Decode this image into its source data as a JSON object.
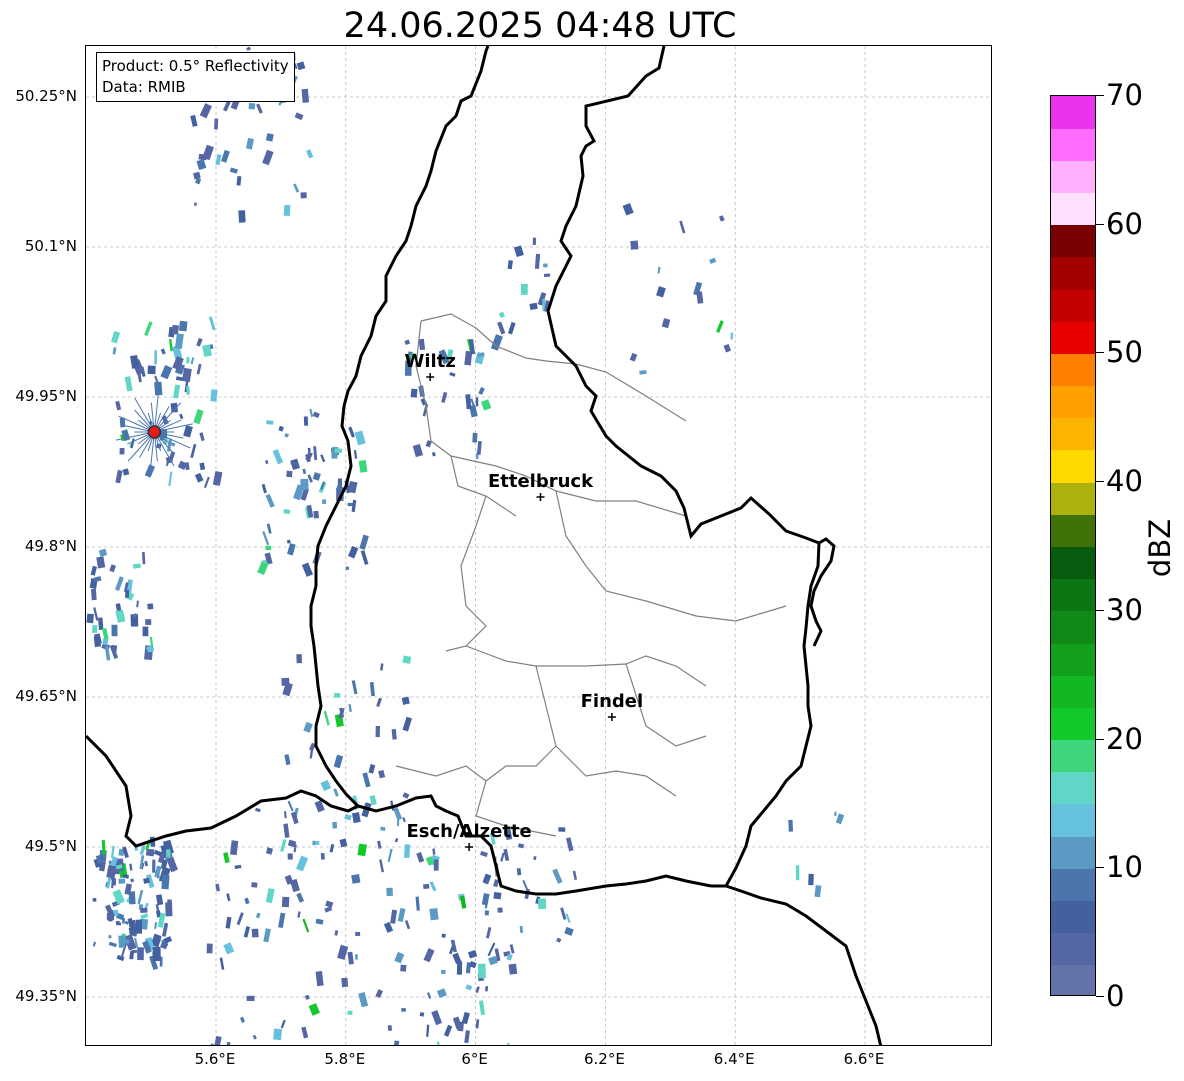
{
  "title": "24.06.2025 04:48 UTC",
  "info": {
    "product": "Product: 0.5° Reflectivity",
    "data_source": "Data: RMIB"
  },
  "axes": {
    "lon_range": [
      5.4,
      6.8
    ],
    "lat_range": [
      49.3,
      50.3
    ],
    "x_ticks": [
      {
        "value": 5.6,
        "label": "5.6°E"
      },
      {
        "value": 5.8,
        "label": "5.8°E"
      },
      {
        "value": 6.0,
        "label": "6°E"
      },
      {
        "value": 6.2,
        "label": "6.2°E"
      },
      {
        "value": 6.4,
        "label": "6.4°E"
      },
      {
        "value": 6.6,
        "label": "6.6°E"
      }
    ],
    "y_ticks": [
      {
        "value": 50.25,
        "label": "50.25°N"
      },
      {
        "value": 50.1,
        "label": "50.1°N"
      },
      {
        "value": 49.95,
        "label": "49.95°N"
      },
      {
        "value": 49.8,
        "label": "49.8°N"
      },
      {
        "value": 49.65,
        "label": "49.65°N"
      },
      {
        "value": 49.5,
        "label": "49.5°N"
      },
      {
        "value": 49.35,
        "label": "49.35°N"
      }
    ],
    "grid": true
  },
  "cities": [
    {
      "name": "Wiltz",
      "lon": 5.93,
      "lat": 49.97
    },
    {
      "name": "Ettelbruck",
      "lon": 6.1,
      "lat": 49.85
    },
    {
      "name": "Findel",
      "lon": 6.21,
      "lat": 49.63
    },
    {
      "name": "Esch/Alzette",
      "lon": 5.99,
      "lat": 49.5
    }
  ],
  "radar_site": {
    "lon": 5.505,
    "lat": 49.915,
    "color": "#e41a1c"
  },
  "colorbar": {
    "label": "dBZ",
    "min": 0,
    "max": 70,
    "ticks": [
      {
        "value": 0,
        "label": "0"
      },
      {
        "value": 10,
        "label": "10"
      },
      {
        "value": 20,
        "label": "20"
      },
      {
        "value": 30,
        "label": "30"
      },
      {
        "value": 40,
        "label": "40"
      },
      {
        "value": 50,
        "label": "50"
      },
      {
        "value": 60,
        "label": "60"
      },
      {
        "value": 70,
        "label": "70"
      }
    ],
    "colors": [
      "#6373a8",
      "#5466a3",
      "#44619f",
      "#4b76ad",
      "#5b9ac3",
      "#66c1dd",
      "#60d6c6",
      "#3ed67c",
      "#13c82a",
      "#13b623",
      "#129f1c",
      "#0f8a17",
      "#0c7514",
      "#075c10",
      "#41720a",
      "#adb10e",
      "#ffd800",
      "#fbb500",
      "#ff9f00",
      "#ff7f00",
      "#e80000",
      "#c40000",
      "#a30000",
      "#780000",
      "#ffe0ff",
      "#ffb1ff",
      "#ff6cff",
      "#ea33ea"
    ]
  },
  "echo_regions": [
    {
      "lon": 5.65,
      "lat": 50.21,
      "spread": 0.09,
      "count": 40
    },
    {
      "lon": 5.52,
      "lat": 49.95,
      "spread": 0.08,
      "count": 70
    },
    {
      "lon": 5.75,
      "lat": 49.86,
      "spread": 0.08,
      "count": 60
    },
    {
      "lon": 5.47,
      "lat": 49.45,
      "spread": 0.06,
      "count": 110
    },
    {
      "lon": 5.7,
      "lat": 49.42,
      "spread": 0.12,
      "count": 60
    },
    {
      "lon": 5.95,
      "lat": 49.4,
      "spread": 0.1,
      "count": 70
    },
    {
      "lon": 5.8,
      "lat": 49.6,
      "spread": 0.1,
      "count": 50
    },
    {
      "lon": 5.95,
      "lat": 49.95,
      "spread": 0.06,
      "count": 30
    },
    {
      "lon": 6.05,
      "lat": 50.07,
      "spread": 0.06,
      "count": 15
    },
    {
      "lon": 6.3,
      "lat": 50.05,
      "spread": 0.1,
      "count": 15
    },
    {
      "lon": 5.45,
      "lat": 49.75,
      "spread": 0.05,
      "count": 40
    },
    {
      "lon": 6.5,
      "lat": 49.5,
      "spread": 0.06,
      "count": 6
    },
    {
      "lon": 6.08,
      "lat": 49.45,
      "spread": 0.07,
      "count": 25
    }
  ]
}
